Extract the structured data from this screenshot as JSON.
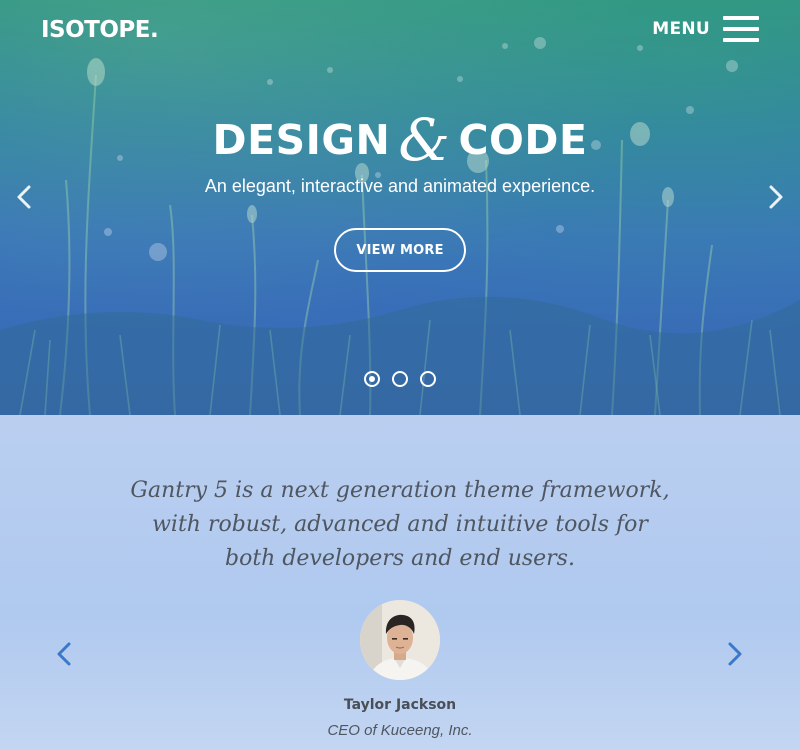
{
  "header": {
    "logo": "ISOTOPE.",
    "menu_label": "MENU"
  },
  "hero": {
    "title_left": "DESIGN",
    "title_amp": "&",
    "title_right": "CODE",
    "subtitle": "An elegant, interactive and animated experience.",
    "cta_label": "VIEW MORE",
    "slides_total": 3,
    "active_slide": 1,
    "icons": {
      "prev": "chevron-left-icon",
      "next": "chevron-right-icon",
      "menu": "hamburger-icon"
    }
  },
  "testimonial": {
    "quote_lines": [
      "Gantry 5 is a next generation theme framework,",
      "with robust, advanced and intuitive tools for",
      "both developers and end users."
    ],
    "name": "Taylor Jackson",
    "role": "CEO of Kuceeng, Inc.",
    "icons": {
      "prev": "chevron-left-icon",
      "next": "chevron-right-icon"
    }
  },
  "colors": {
    "hero_gradient_top": "#2c8f8a",
    "hero_gradient_bottom": "#3b6aae",
    "testimonial_bg": "#b9cff0",
    "accent_arrow": "#3a78c9",
    "text_dark": "#4f5660"
  }
}
